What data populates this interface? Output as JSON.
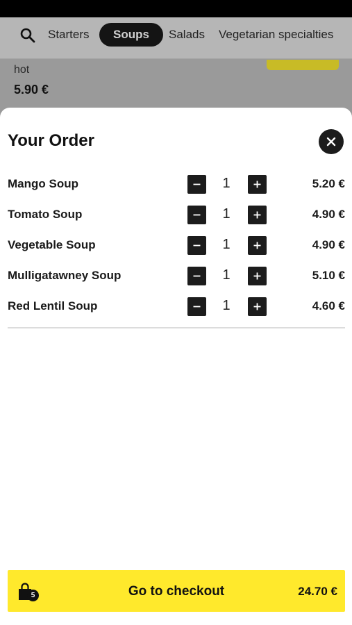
{
  "categories": [
    {
      "label": "Starters",
      "active": false
    },
    {
      "label": "Soups",
      "active": true
    },
    {
      "label": "Salads",
      "active": false
    },
    {
      "label": "Vegetarian specialties",
      "active": false
    }
  ],
  "background_item": {
    "subtitle": "hot",
    "price": "5.90 €"
  },
  "order": {
    "title": "Your Order",
    "items": [
      {
        "name": "Mango Soup",
        "qty": "1",
        "price": "5.20 €"
      },
      {
        "name": "Tomato Soup",
        "qty": "1",
        "price": "4.90 €"
      },
      {
        "name": "Vegetable Soup",
        "qty": "1",
        "price": "4.90 €"
      },
      {
        "name": "Mulligatawney Soup",
        "qty": "1",
        "price": "5.10 €"
      },
      {
        "name": "Red Lentil Soup",
        "qty": "1",
        "price": "4.60 €"
      }
    ]
  },
  "checkout": {
    "label": "Go to checkout",
    "count": "5",
    "total": "24.70 €"
  },
  "colors": {
    "accent": "#ffe92c",
    "dark": "#1c1c1c"
  },
  "icons": {
    "search": "search-icon",
    "close": "close-icon",
    "bag": "shopping-bag-icon",
    "minus": "minus-icon",
    "plus": "plus-icon"
  }
}
